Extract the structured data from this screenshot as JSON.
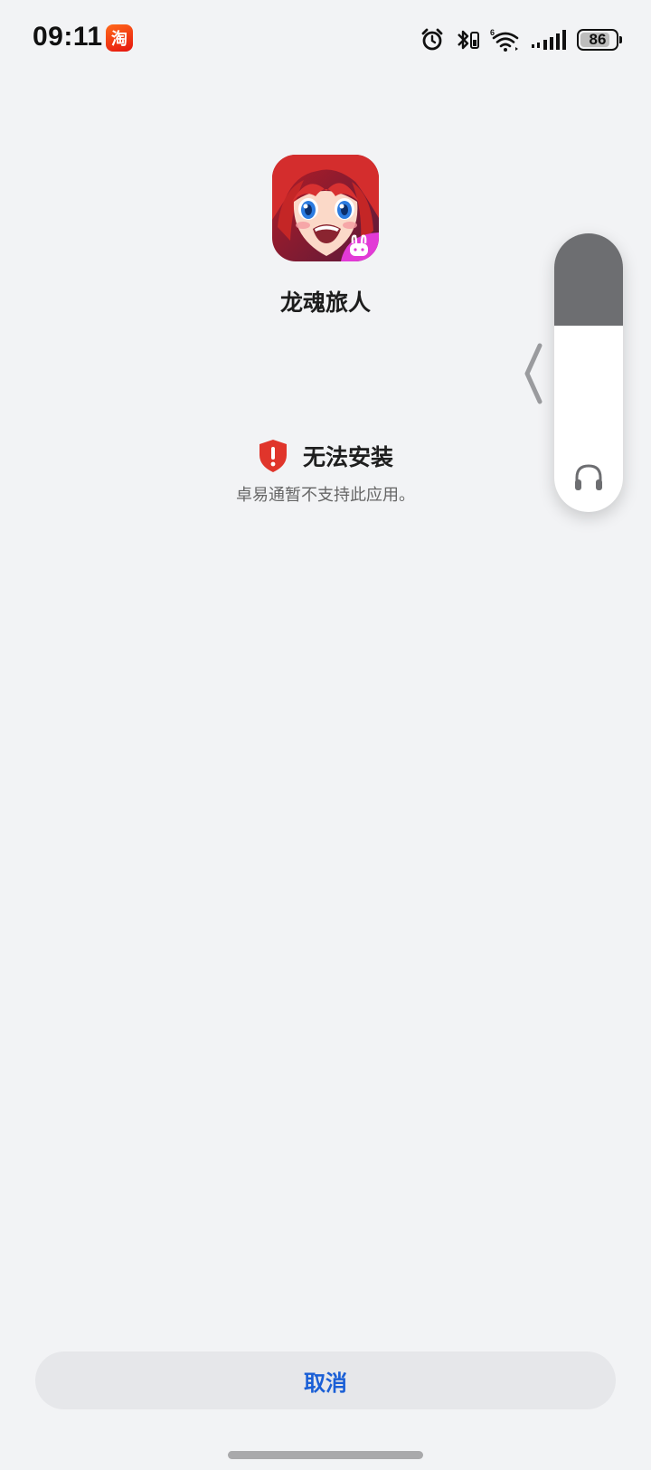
{
  "status_bar": {
    "time": "09:11",
    "notification_icon": "taobao-app-icon",
    "notification_icon_glyph": "淘",
    "battery_level": "86",
    "icons": [
      "alarm-icon",
      "bluetooth-icon",
      "wifi-icon",
      "signal-icon",
      "battery-icon"
    ]
  },
  "app": {
    "name": "龙魂旅人",
    "icon": "app-icon-anime-character"
  },
  "install_status": {
    "title": "无法安装",
    "description": "卓易通暂不支持此应用。",
    "icon": "shield-alert-icon",
    "color": "#e0352b"
  },
  "side_panel": {
    "level_fraction": 0.33,
    "icon": "headphones-icon"
  },
  "actions": {
    "cancel_label": "取消",
    "accent": "#1a5fd6"
  }
}
